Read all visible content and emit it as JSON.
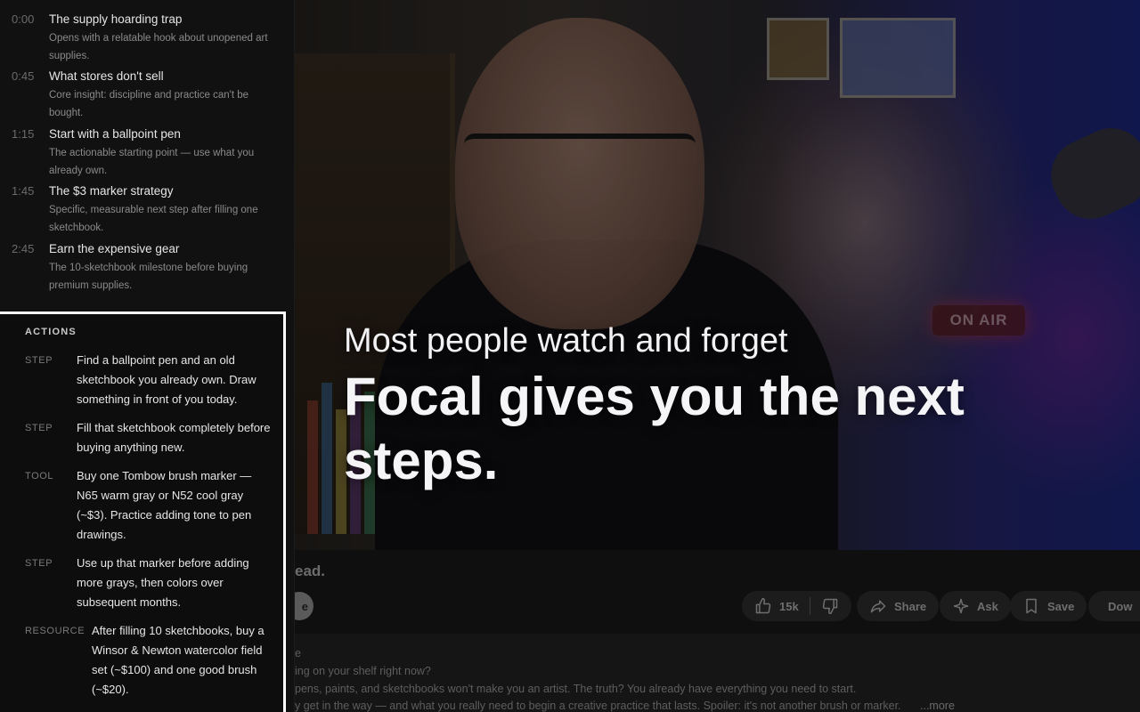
{
  "chapters": [
    {
      "time": "0:00",
      "title": "The supply hoarding trap",
      "desc": "Opens with a relatable hook about unopened art supplies."
    },
    {
      "time": "0:45",
      "title": "What stores don't sell",
      "desc": "Core insight: discipline and practice can't be bought."
    },
    {
      "time": "1:15",
      "title": "Start with a ballpoint pen",
      "desc": "The actionable starting point — use what you already own."
    },
    {
      "time": "1:45",
      "title": "The $3 marker strategy",
      "desc": "Specific, measurable next step after filling one sketchbook."
    },
    {
      "time": "2:45",
      "title": "Earn the expensive gear",
      "desc": "The 10-sketchbook milestone before buying premium supplies."
    }
  ],
  "actions": {
    "heading": "ACTIONS",
    "items": [
      {
        "type": "STEP",
        "text": "Find a ballpoint pen and an old sketchbook you already own. Draw something in front of you today."
      },
      {
        "type": "STEP",
        "text": "Fill that sketchbook completely before buying anything new."
      },
      {
        "type": "TOOL",
        "text": "Buy one Tombow brush marker — N65 warm gray or N52 cool gray (~$3). Practice adding tone to pen drawings."
      },
      {
        "type": "STEP",
        "text": "Use up that marker before adding more grays, then colors over subsequent months."
      },
      {
        "type": "RESOURCE",
        "text": "After filling 10 sketchbooks, buy a Winsor & Newton watercolor field set (~$100) and one good brush (~$20)."
      }
    ]
  },
  "hero": {
    "line1": "Most people watch and forget",
    "line2": "Focal gives you the next steps."
  },
  "video": {
    "onair_sign": "ON AIR",
    "title_fragment": "ead.",
    "subscribe_fragment": "e"
  },
  "toolbar": {
    "likes": "15k",
    "share": "Share",
    "ask": "Ask",
    "save": "Save",
    "download": "Dow"
  },
  "description": {
    "line0": "e",
    "line1": "ing on your shelf right now?",
    "line2": "pens, paints, and sketchbooks won't make you an artist. The truth? You already have everything you need to start.",
    "line3": "y get in the way — and what you really need to begin a creative practice that lasts. Spoiler: it's not another brush or marker.",
    "more": "...more"
  }
}
